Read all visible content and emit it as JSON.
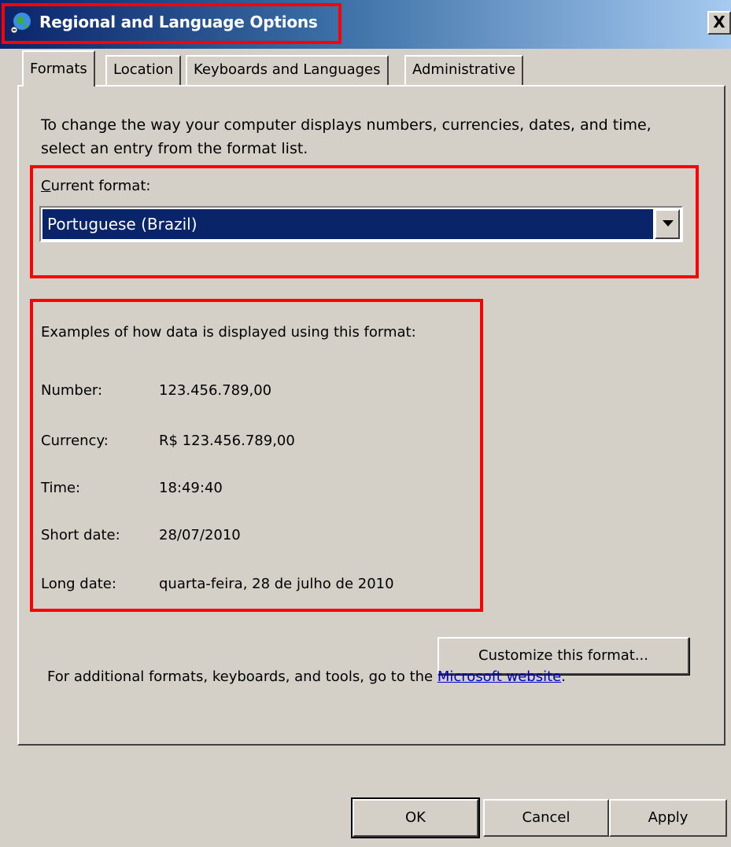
{
  "window": {
    "title": "Regional and Language Options",
    "close_label": "X"
  },
  "tabs": [
    {
      "label": "Formats",
      "active": true
    },
    {
      "label": "Location",
      "active": false
    },
    {
      "label": "Keyboards and Languages",
      "active": false
    },
    {
      "label": "Administrative",
      "active": false
    }
  ],
  "formats": {
    "intro": "To change the way your computer displays numbers, currencies, dates, and time, select an entry from the format list.",
    "current_format_label": "Current format:",
    "current_format_value": "Portuguese (Brazil)",
    "examples_heading": "Examples of how data is displayed using this format:",
    "examples": [
      {
        "label": "Number:",
        "value": "123.456.789,00"
      },
      {
        "label": "Currency:",
        "value": "R$ 123.456.789,00"
      },
      {
        "label": "Time:",
        "value": "18:49:40"
      },
      {
        "label": "Short date:",
        "value": "28/07/2010"
      },
      {
        "label": "Long date:",
        "value": "quarta-feira, 28 de julho de 2010"
      }
    ],
    "customize_label": "Customize this format...",
    "footer_text": "For additional formats, keyboards, and tools, go to the ",
    "footer_link": "Microsoft website",
    "footer_end": "."
  },
  "buttons": {
    "ok": "OK",
    "cancel": "Cancel",
    "apply": "Apply"
  },
  "colors": {
    "highlight": "#ff0000",
    "selection": "#0a246a",
    "dialog_bg": "#d4d0c8",
    "link": "#0000cc"
  }
}
